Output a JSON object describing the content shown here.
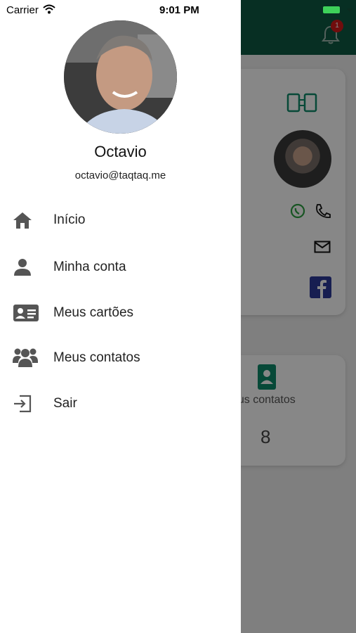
{
  "status_bar": {
    "carrier": "Carrier",
    "time": "9:01 PM"
  },
  "profile": {
    "name": "Octavio",
    "email": "octavio@taqtaq.me"
  },
  "menu": {
    "items": [
      {
        "label": "Início",
        "icon": "home-icon"
      },
      {
        "label": "Minha conta",
        "icon": "person-icon"
      },
      {
        "label": "Meus cartões",
        "icon": "id-card-icon"
      },
      {
        "label": "Meus contatos",
        "icon": "group-icon"
      },
      {
        "label": "Sair",
        "icon": "logout-icon"
      }
    ]
  },
  "background": {
    "notification_count": "1",
    "contacts_label": "eus contatos",
    "contacts_count": "8"
  },
  "colors": {
    "brand_green": "#0e5a43",
    "badge_red": "#d31a1a",
    "whatsapp_green": "#2ea043",
    "facebook_blue": "#2d3a9a"
  }
}
